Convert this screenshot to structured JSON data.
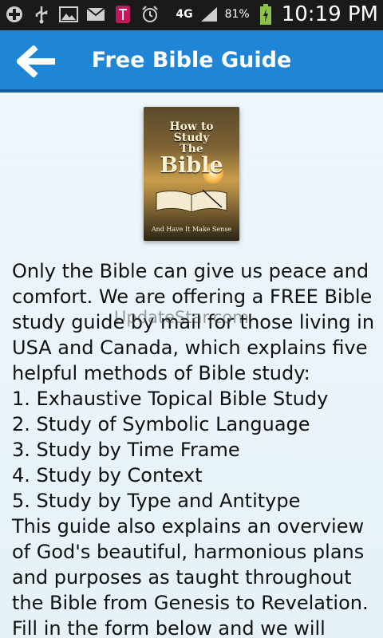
{
  "status_bar": {
    "icons": [
      "add-icon",
      "usb-icon",
      "image-icon",
      "mail-icon",
      "t-mobile-icon",
      "alarm-icon"
    ],
    "network": "4G",
    "battery_percent": "81%",
    "time": "10:19 PM"
  },
  "app_bar": {
    "title": "Free Bible Guide",
    "back_icon": "back-arrow-icon",
    "color": "#1f86d6"
  },
  "book": {
    "title_line1": "How to",
    "title_line2": "Study",
    "title_line3": "The",
    "title_line4": "Bible",
    "subtitle": "And Have It Make Sense"
  },
  "content": {
    "body": "Only the Bible can give us peace and comfort. We are offering a FREE Bible study guide by mail for those living in USA and Canada, which explains five helpful methods of Bible study:\n1. Exhaustive Topical Bible Study\n2. Study of Symbolic Language\n3. Study by Time Frame\n4. Study by Context\n5. Study by Type and Antitype\nThis guide also explains an overview of God's beautiful, harmonious plans and purposes as taught throughout the Bible from Genesis to Revelation.\nFill in the form below and we will",
    "watermark": "UpdateStar.com"
  }
}
